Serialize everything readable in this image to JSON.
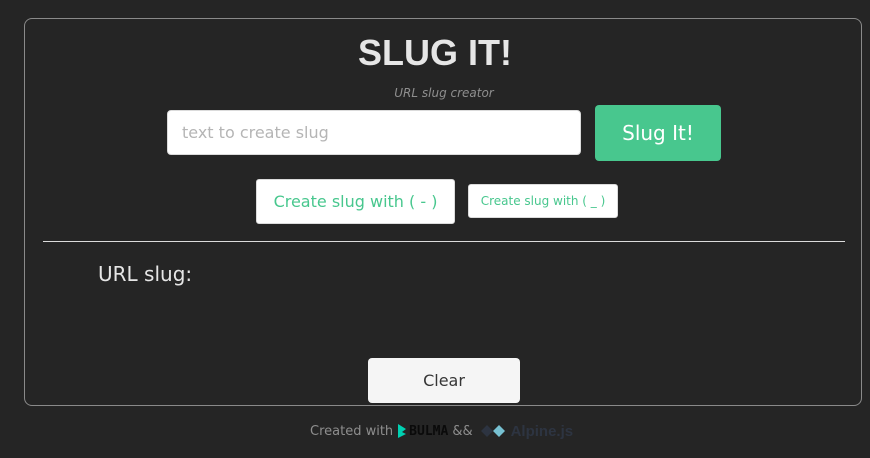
{
  "header": {
    "title": "SLUG IT!",
    "subtitle": "URL slug creator"
  },
  "form": {
    "input_value": "",
    "input_placeholder": "text to create slug",
    "submit_label": "Slug It!"
  },
  "options": {
    "dash_label": "Create slug with ( - )",
    "underscore_label": "Create slug with ( _ )"
  },
  "result": {
    "label": "URL slug:",
    "value": ""
  },
  "actions": {
    "clear_label": "Clear"
  },
  "footer": {
    "prefix": "Created with",
    "separator": "&&",
    "bulma_text": "BULMA",
    "alpine_text": "Alpine.js"
  },
  "colors": {
    "background": "#252525",
    "accent": "#48c78e",
    "card_border": "#8a8a8a",
    "bulma_icon": "#00d1b2",
    "alpine_dark": "#2d3441",
    "alpine_light": "#77c1d2"
  },
  "icons": [
    "bulma-logo-icon",
    "alpine-logo-icon"
  ]
}
